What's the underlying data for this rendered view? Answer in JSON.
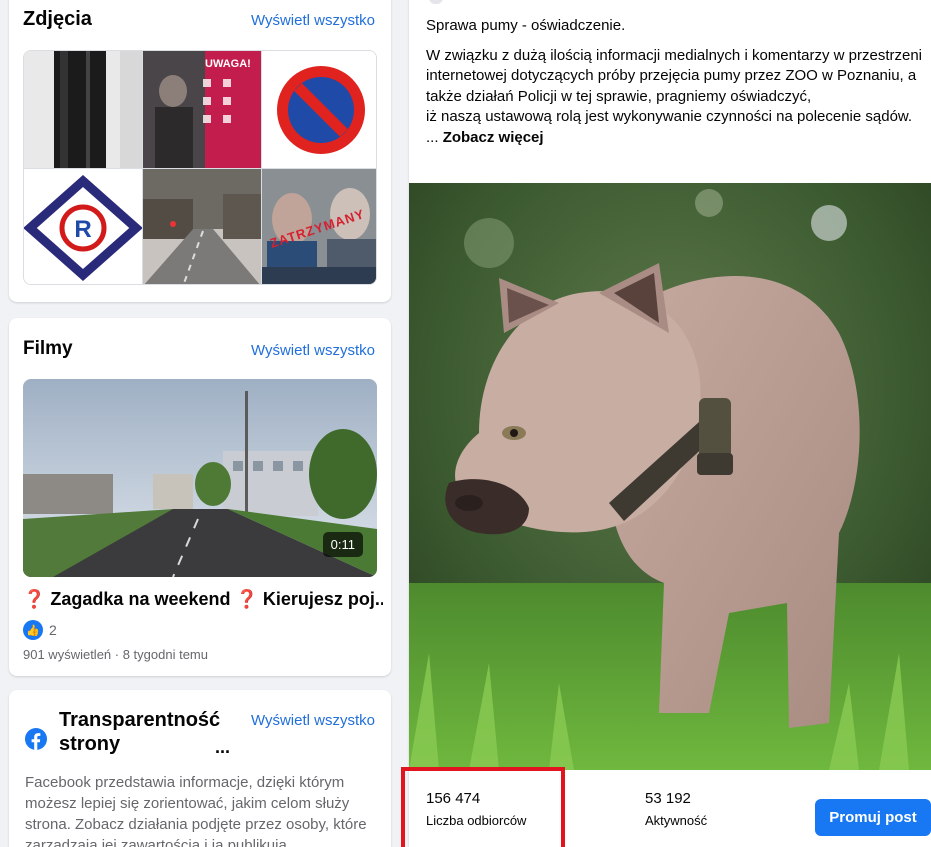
{
  "photos": {
    "title": "Zdjęcia",
    "see_all": "Wyświetl wszystko",
    "overlay_texts": {
      "warning_header": "UWAGA!",
      "arrested_stamp": "ZATRZYMANY"
    }
  },
  "videos": {
    "title": "Filmy",
    "see_all": "Wyświetl wszystko",
    "duration": "0:11",
    "video_title": "❓ Zagadka na weekend ❓ Kierujesz poj...",
    "likes": "2",
    "meta": "901 wyświetleń · 8 tygodni temu"
  },
  "transparency": {
    "title": "Transparentność strony",
    "ellipsis": "...",
    "see_all": "Wyświetl wszystko",
    "description": "Facebook przedstawia informacje, dzięki którym możesz lepiej się zorientować, jakim celom służy strona. Zobacz działania podjęte przez osoby, które zarządzają jej zawartością i ją publikują."
  },
  "post": {
    "line1": "Sprawa pumy - oświadczenie.",
    "line2": "W związku z dużą ilością informacji medialnych i komentarzy w przestrzeni internetowej dotyczących próby przejęcia pumy przez ZOO w Poznaniu, a także działań Policji w tej sprawie, pragniemy oświadczyć,",
    "line3": "iż naszą ustawową rolą jest wykonywanie czynności na polecenie sądów.  ...",
    "see_more": "Zobacz więcej",
    "reach_value": "156 474",
    "reach_label": "Liczba odbiorców",
    "engagement_value": "53 192",
    "engagement_label": "Aktywność",
    "promote_label": "Promuj post"
  },
  "colors": {
    "accent": "#1877f2",
    "link": "#216fdb",
    "highlight": "#e1141f"
  }
}
